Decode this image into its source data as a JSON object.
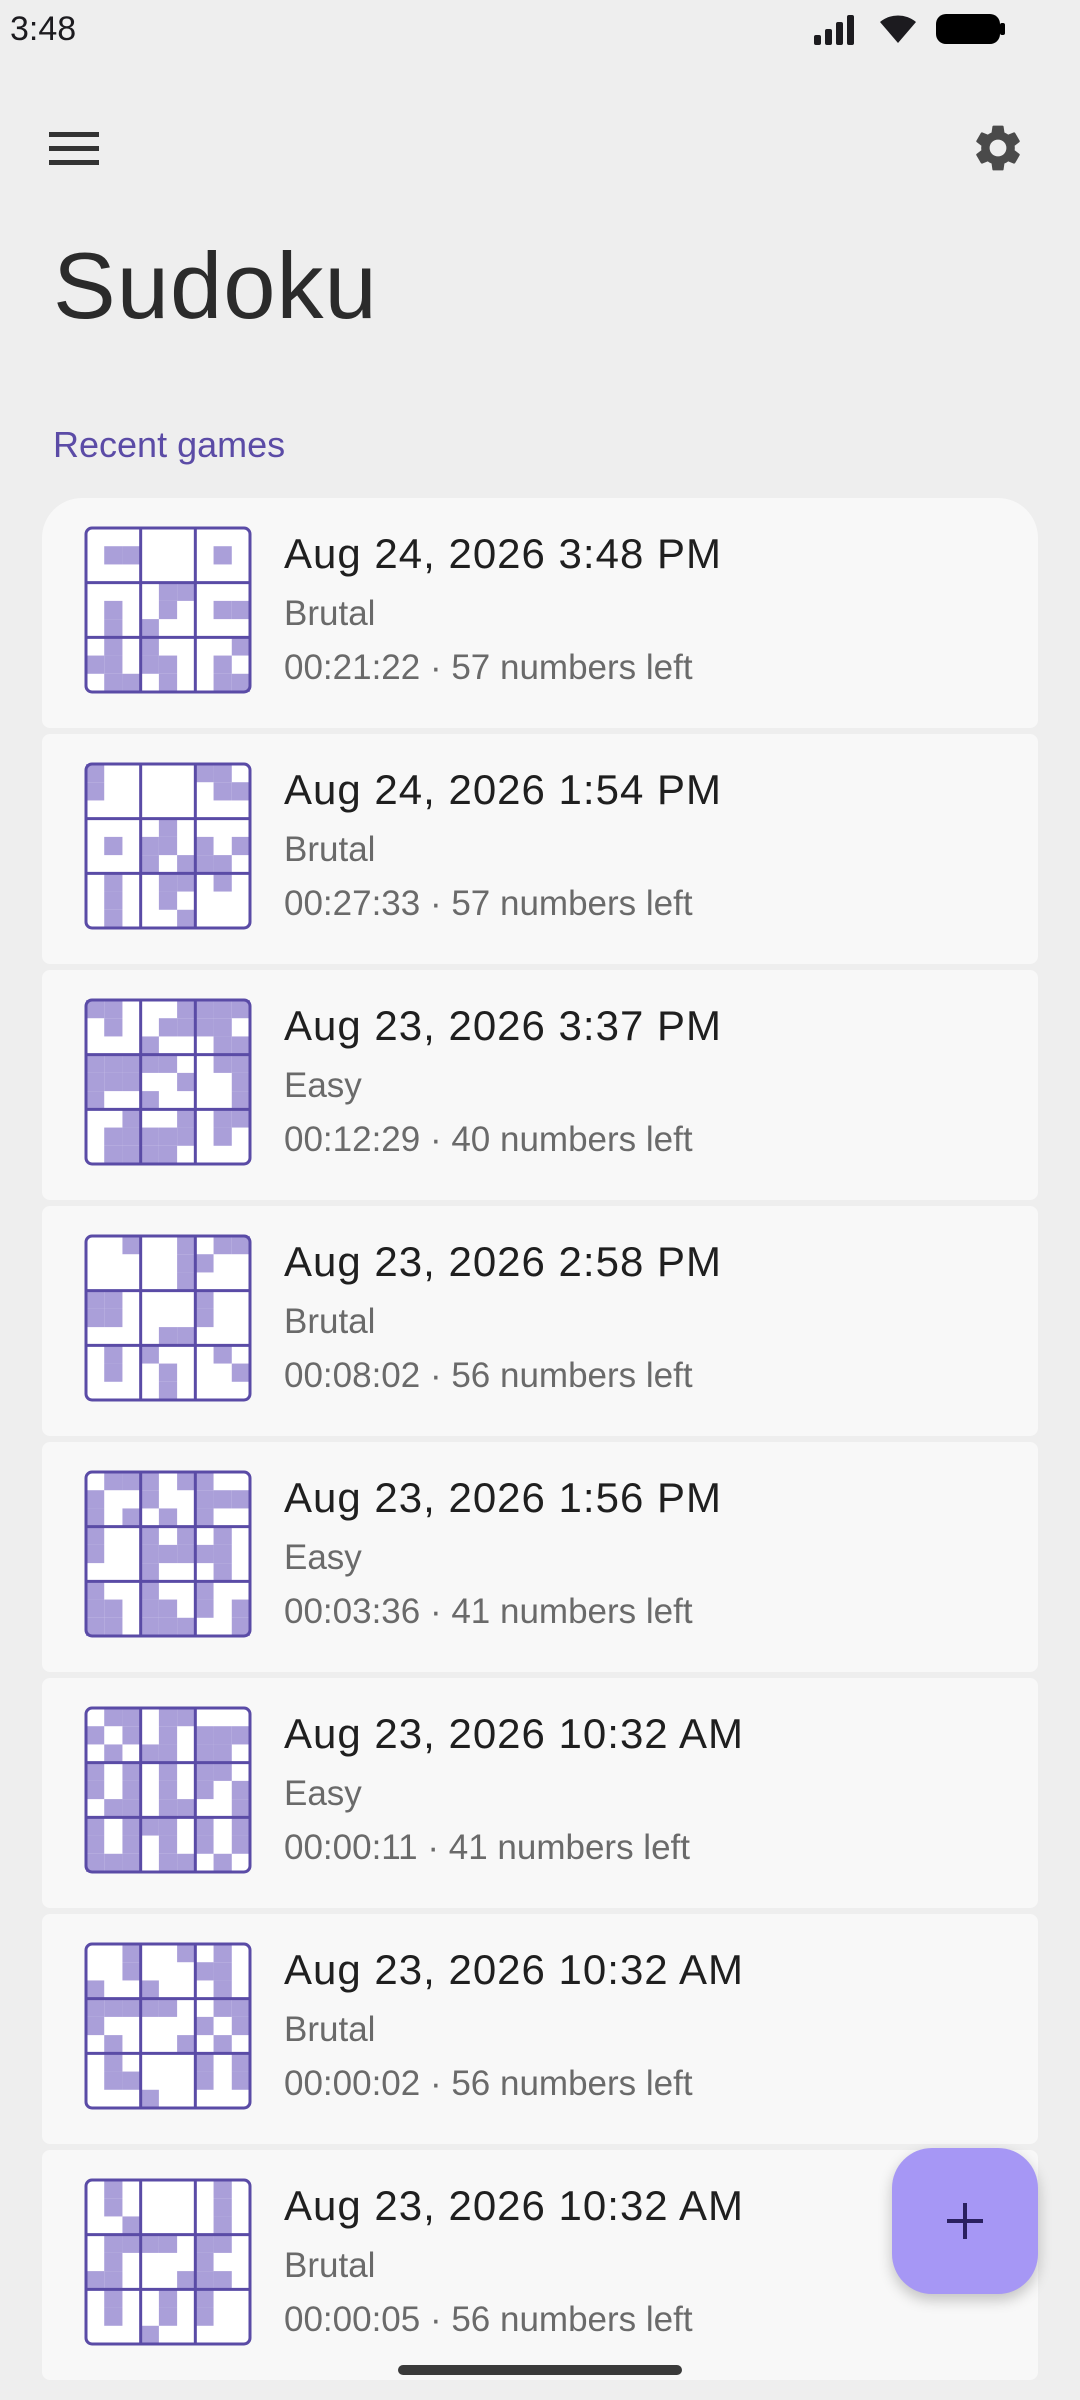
{
  "status_bar": {
    "time": "3:48"
  },
  "app_bar": {
    "menu_icon": "hamburger-menu-icon",
    "settings_icon": "gear-icon"
  },
  "title": "Sudoku",
  "section_label": "Recent games",
  "colors": {
    "accent": "#5b4ba6",
    "grid_fill": "#aa9fd9",
    "grid_line": "#5a4ba6",
    "fab": "#a697f5",
    "card": "#f8f8f8",
    "background": "#eeeeee"
  },
  "games": [
    {
      "date": "Aug 24, 2026 3:48 PM",
      "difficulty": "Brutal",
      "progress": "00:21:22 · 57 numbers left",
      "filled_cells": [
        10,
        11,
        16,
        31,
        32,
        37,
        40,
        43,
        44,
        46,
        48,
        55,
        57,
        62,
        63,
        64,
        66,
        67,
        70,
        73,
        74,
        76,
        79,
        80
      ]
    },
    {
      "date": "Aug 24, 2026 1:54 PM",
      "difficulty": "Brutal",
      "progress": "00:27:33 · 57 numbers left",
      "filled_cells": [
        0,
        6,
        7,
        9,
        16,
        17,
        31,
        37,
        39,
        40,
        42,
        44,
        48,
        50,
        51,
        52,
        55,
        58,
        59,
        61,
        64,
        67,
        73,
        77
      ]
    },
    {
      "date": "Aug 23, 2026 3:37 PM",
      "difficulty": "Easy",
      "progress": "00:12:29 · 40 numbers left",
      "filled_cells": [
        0,
        1,
        5,
        6,
        7,
        8,
        10,
        13,
        14,
        15,
        16,
        21,
        25,
        26,
        27,
        28,
        29,
        30,
        31,
        34,
        35,
        36,
        37,
        38,
        41,
        44,
        45,
        48,
        53,
        56,
        59,
        61,
        62,
        64,
        65,
        66,
        67,
        68,
        70,
        73,
        74,
        75,
        76
      ]
    },
    {
      "date": "Aug 23, 2026 2:58 PM",
      "difficulty": "Brutal",
      "progress": "00:08:02 · 56 numbers left",
      "filled_cells": [
        2,
        5,
        7,
        8,
        14,
        15,
        23,
        27,
        28,
        33,
        36,
        37,
        42,
        49,
        50,
        55,
        57,
        61,
        64,
        67,
        71,
        76
      ]
    },
    {
      "date": "Aug 23, 2026 1:56 PM",
      "difficulty": "Easy",
      "progress": "00:03:36 · 41 numbers left",
      "filled_cells": [
        1,
        2,
        3,
        5,
        6,
        9,
        12,
        15,
        16,
        17,
        18,
        20,
        22,
        24,
        27,
        30,
        32,
        34,
        36,
        39,
        40,
        41,
        42,
        43,
        48,
        52,
        54,
        57,
        60,
        63,
        64,
        66,
        67,
        69,
        71,
        72,
        73,
        75,
        76,
        77,
        80
      ]
    },
    {
      "date": "Aug 23, 2026 10:32 AM",
      "difficulty": "Easy",
      "progress": "00:00:11 · 41 numbers left",
      "filled_cells": [
        1,
        2,
        4,
        5,
        9,
        11,
        13,
        15,
        16,
        17,
        19,
        21,
        22,
        24,
        25,
        27,
        29,
        31,
        33,
        34,
        36,
        38,
        40,
        42,
        44,
        46,
        47,
        49,
        50,
        53,
        54,
        56,
        57,
        58,
        60,
        62,
        63,
        65,
        67,
        69,
        71,
        72,
        73,
        74,
        76,
        77,
        79
      ]
    },
    {
      "date": "Aug 23, 2026 10:32 AM",
      "difficulty": "Brutal",
      "progress": "00:00:02 · 56 numbers left",
      "filled_cells": [
        2,
        5,
        7,
        11,
        15,
        16,
        18,
        21,
        25,
        27,
        28,
        29,
        30,
        31,
        34,
        35,
        36,
        42,
        44,
        46,
        50,
        52,
        55,
        60,
        62,
        64,
        65,
        69,
        71,
        75
      ]
    },
    {
      "date": "Aug 23, 2026 10:32 AM",
      "difficulty": "Brutal",
      "progress": "00:00:05 · 56 numbers left",
      "filled_cells": [
        1,
        7,
        10,
        16,
        20,
        25,
        28,
        29,
        30,
        31,
        33,
        34,
        37,
        42,
        45,
        46,
        50,
        51,
        52,
        55,
        58,
        60,
        64,
        67,
        69,
        75
      ]
    }
  ]
}
